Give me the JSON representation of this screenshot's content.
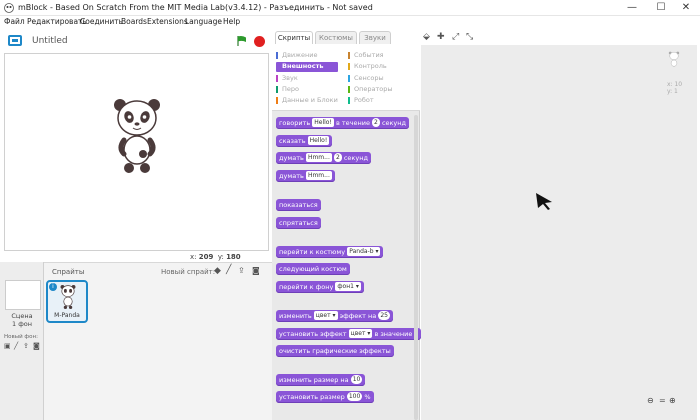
{
  "window": {
    "title": "mBlock - Based On Scratch From the MIT Media Lab(v3.4.12) - Разъединить - Not saved",
    "minimize": "—",
    "maximize": "☐",
    "close": "✕"
  },
  "menu": [
    "Файл",
    "Редактировать",
    "Соединить",
    "Boards",
    "Extensions",
    "Language",
    "Help"
  ],
  "stage": {
    "project_name": "Untitled",
    "coords_x_label": "x:",
    "coords_x": "209",
    "coords_y_label": "y:",
    "coords_y": "180"
  },
  "sprites": {
    "header": "Спрайты",
    "new_sprite_label": "Новый спрайт:",
    "scene_label": "Сцена",
    "scene_sub": "1 фон",
    "new_backdrop_label": "Новый фон:",
    "sprite_name": "M-Panda"
  },
  "tabs": [
    "Скрипты",
    "Костюмы",
    "Звуки"
  ],
  "categories": [
    {
      "label": "Движение",
      "color": "#4a6cd4"
    },
    {
      "label": "Внешность",
      "color": "#8a55d7",
      "active": true
    },
    {
      "label": "Звук",
      "color": "#bb42c3"
    },
    {
      "label": "Перо",
      "color": "#0e9a6c"
    },
    {
      "label": "Данные и Блоки",
      "color": "#ee7d16"
    },
    {
      "label": "События",
      "color": "#c88330"
    },
    {
      "label": "Контроль",
      "color": "#e1a91a"
    },
    {
      "label": "Сенсоры",
      "color": "#2ca5e2"
    },
    {
      "label": "Операторы",
      "color": "#5cb712"
    },
    {
      "label": "Робот",
      "color": "#0fbd8c"
    }
  ],
  "blocks": {
    "say_for": {
      "pre": "говорить",
      "v1": "Hello!",
      "mid": "в течение",
      "v2": "2",
      "post": "секунд"
    },
    "say": {
      "pre": "сказать",
      "v1": "Hello!"
    },
    "think_for": {
      "pre": "думать",
      "v1": "Hmm...",
      "v2": "2",
      "post": "секунд"
    },
    "think": {
      "pre": "думать",
      "v1": "Hmm..."
    },
    "show": "показаться",
    "hide": "спрятаться",
    "switch_costume": {
      "pre": "перейти к костюму",
      "v1": "Panda-b"
    },
    "next_costume": "следующий костюм",
    "switch_backdrop": {
      "pre": "перейти к фону",
      "v1": "фон1"
    },
    "change_effect": {
      "pre": "изменить",
      "v1": "цвет",
      "mid": "эффект на",
      "v2": "25"
    },
    "set_effect": {
      "pre": "установить эффект",
      "v1": "цвет",
      "post": "в значение"
    },
    "clear_effects": "очистить графические эффекты",
    "change_size": {
      "pre": "изменить размер на",
      "v1": "10"
    },
    "set_size": {
      "pre": "установить размер",
      "v1": "100",
      "post": "%"
    }
  },
  "scripts_area": {
    "sprite_x": "x: 10",
    "sprite_y": "y: 1"
  },
  "colors": {
    "looks": "#8a55d7",
    "accent_blue": "#1e88c8",
    "green_flag": "#2d9a2d",
    "stop": "#e02020"
  }
}
